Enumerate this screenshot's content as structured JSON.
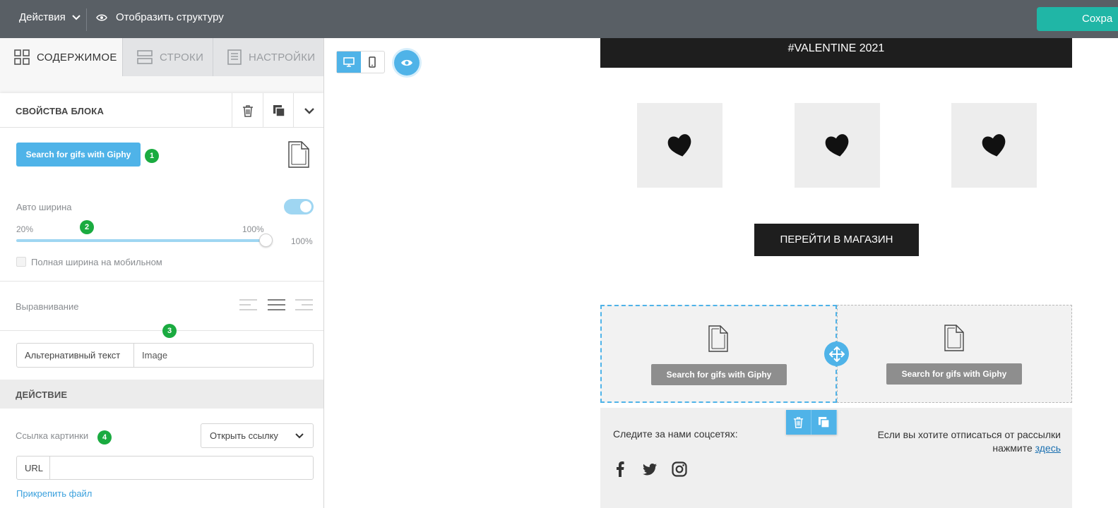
{
  "topbar": {
    "actions_label": "Действия",
    "structure_label": "Отобразить структуру",
    "save_label": "Сохра"
  },
  "tabs": [
    {
      "label": "СОДЕРЖИМОЕ",
      "active": true
    },
    {
      "label": "СТРОКИ",
      "active": false
    },
    {
      "label": "НАСТРОЙКИ",
      "active": false
    }
  ],
  "block_properties": {
    "title": "СВОЙСТВА БЛОКА",
    "giphy_button": "Search for gifs with Giphy",
    "auto_width_label": "Авто ширина",
    "auto_width_enabled": true,
    "slider_min_label": "20%",
    "slider_max_label": "100%",
    "slider_value": "100%",
    "slider_fraction": 1.0,
    "full_width_mobile_label": "Полная ширина на мобильном",
    "full_width_mobile_checked": false,
    "alignment_label": "Выравнивание",
    "alignment_selected": "center",
    "alt_text_label": "Альтернативный текст",
    "alt_text_value": "Image"
  },
  "badges": [
    "1",
    "2",
    "3",
    "4"
  ],
  "action_section": {
    "title": "ДЕЙСТВИЕ",
    "image_link_label": "Ссылка картинки",
    "link_select_value": "Открыть ссылку",
    "url_label": "URL",
    "url_value": "",
    "attach_file_label": "Прикрепить файл"
  },
  "canvas": {
    "device_selected": "desktop",
    "email": {
      "header_banner": "#VALENTINE 2021",
      "shop_button": "ПЕРЕЙТИ В МАГАЗИН",
      "giphy_cells": [
        {
          "button": "Search for gifs with Giphy",
          "selected": true
        },
        {
          "button": "Search for gifs with Giphy",
          "selected": false
        }
      ],
      "footer": {
        "follow_text": "Следите за нами соцсетях:",
        "unsubscribe_text": "Если вы хотите отписаться от рассылки",
        "unsubscribe_prefix": "нажмите",
        "unsubscribe_link": "здесь",
        "social_icons": [
          "facebook-icon",
          "twitter-icon",
          "instagram-icon"
        ]
      }
    }
  },
  "colors": {
    "topbar_bg": "#595f65",
    "accent_teal": "#20b6a6",
    "accent_blue": "#4fb3e8",
    "badge_green": "#1aab40",
    "dark": "#1e1e1e"
  }
}
